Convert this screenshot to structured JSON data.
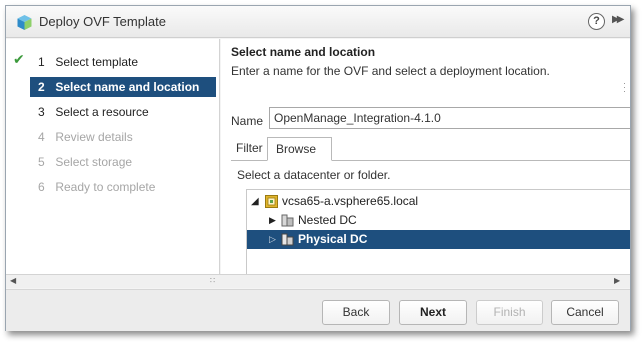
{
  "window": {
    "title": "Deploy OVF Template",
    "help_label": "?",
    "forward_label": "▶▶"
  },
  "sidebar": {
    "steps": [
      {
        "num": "1",
        "label": "Select template",
        "state": "done"
      },
      {
        "num": "2",
        "label": "Select name and location",
        "state": "active"
      },
      {
        "num": "3",
        "label": "Select a resource",
        "state": "next"
      },
      {
        "num": "4",
        "label": "Review details",
        "state": "disabled"
      },
      {
        "num": "5",
        "label": "Select storage",
        "state": "disabled"
      },
      {
        "num": "6",
        "label": "Ready to complete",
        "state": "disabled"
      }
    ]
  },
  "main": {
    "title": "Select name and location",
    "subtitle": "Enter a name for the OVF and select a deployment location.",
    "name_label": "Name",
    "name_value": "OpenManage_Integration-4.1.0",
    "tabs": [
      {
        "label": "Filter",
        "selected": false
      },
      {
        "label": "Browse",
        "selected": true
      }
    ],
    "hint": "Select a datacenter or folder.",
    "tree": [
      {
        "label": "vcsa65-a.vsphere65.local",
        "type": "vcenter",
        "expanded": true,
        "level": 0,
        "selected": false
      },
      {
        "label": "Nested DC",
        "type": "datacenter",
        "expanded": false,
        "level": 1,
        "selected": false
      },
      {
        "label": "Physical DC",
        "type": "datacenter",
        "expanded": false,
        "level": 1,
        "selected": true
      }
    ]
  },
  "footer": {
    "back": "Back",
    "next": "Next",
    "finish": "Finish",
    "cancel": "Cancel"
  },
  "colors": {
    "selection": "#1e4f7e",
    "check": "#3c9a3c",
    "vcenter_icon": "#e1b52c"
  }
}
